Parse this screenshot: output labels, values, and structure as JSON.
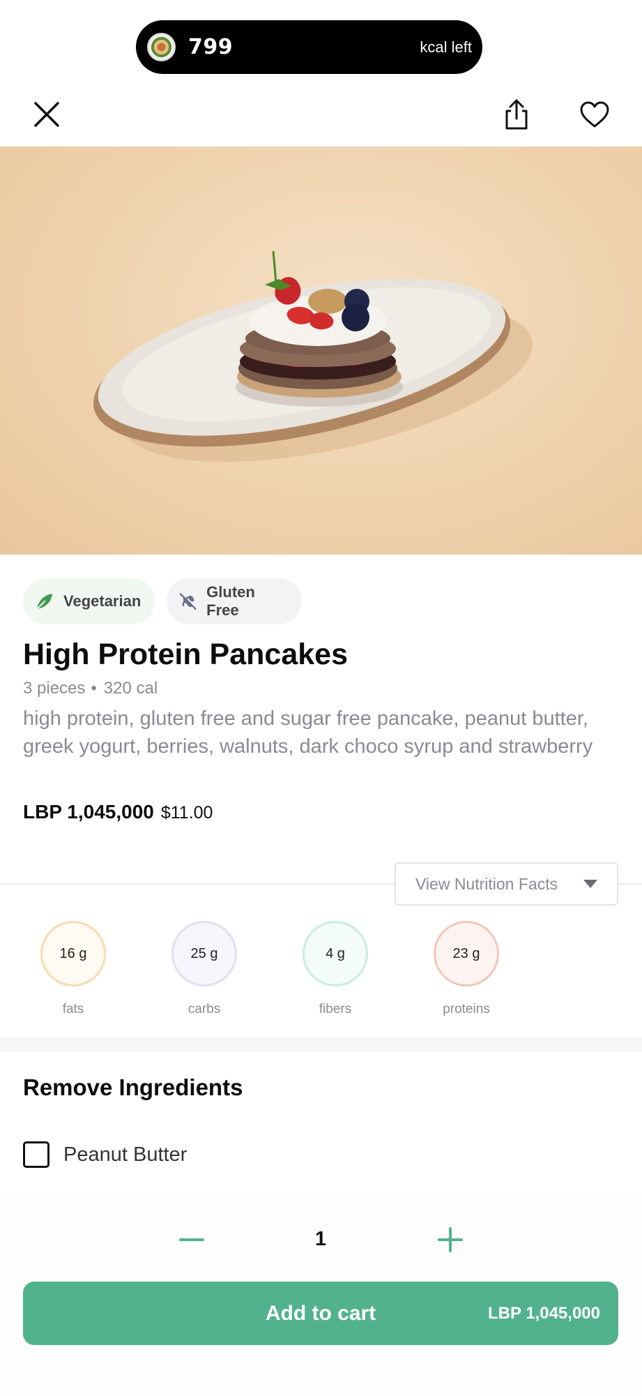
{
  "kcal_banner": {
    "value": "799",
    "label": "kcal left"
  },
  "tags": [
    {
      "label": "Vegetarian",
      "icon": "leaf-icon",
      "color": "#3f9c4a"
    },
    {
      "label": "Gluten Free",
      "icon": "no-wheat-icon",
      "color": "#6b6b8a"
    }
  ],
  "product": {
    "title": "High Protein Pancakes",
    "pieces": "3 pieces",
    "separator": "•",
    "calories": "320 cal",
    "description": "high protein, gluten free and sugar free pancake, peanut butter, greek yogurt, berries, walnuts, dark choco syrup and strawberry",
    "price_lbp": "LBP 1,045,000",
    "price_usd": "$11.00"
  },
  "nutrition_button": {
    "label": "View Nutrition Facts"
  },
  "macros": [
    {
      "value": "16 g",
      "label": "fats",
      "ring_color": "#f6dcae",
      "fill_color": "#fffaf2"
    },
    {
      "value": "25 g",
      "label": "carbs",
      "ring_color": "#e3def1",
      "fill_color": "#f8f6fc"
    },
    {
      "value": "4 g",
      "label": "fibers",
      "ring_color": "#c6eedf",
      "fill_color": "#f3fcf8"
    },
    {
      "value": "23 g",
      "label": "proteins",
      "ring_color": "#f1c7b9",
      "fill_color": "#fdf4f1"
    }
  ],
  "remove_ingredients": {
    "title": "Remove Ingredients",
    "items": [
      {
        "label": "Peanut Butter",
        "checked": false
      }
    ]
  },
  "quantity": {
    "value": "1"
  },
  "cart": {
    "label": "Add to cart",
    "price": "LBP 1,045,000",
    "color": "#52b28e"
  },
  "colors": {
    "accent": "#52b28e"
  }
}
